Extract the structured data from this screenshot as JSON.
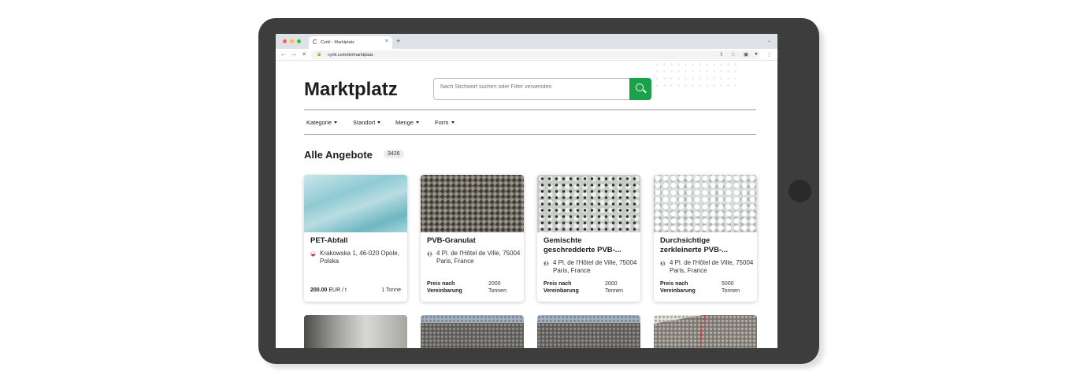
{
  "browser": {
    "tab_title": "Cyrkl - Marktplatz",
    "tab_close": "×",
    "new_tab": "+",
    "tab_menu": "⌄",
    "url": "cyrkl.com/de/marktplatz",
    "nav": {
      "back": "←",
      "forward": "→",
      "stop": "✕"
    },
    "toolbar_icons": {
      "share": "⇧",
      "bookmark": "☆",
      "sidepanel": "▣",
      "profile": "●",
      "menu": "⋮"
    },
    "window_controls": {
      "close": "#ff5f57",
      "minimize": "#febc2e",
      "maximize": "#28c840"
    }
  },
  "header": {
    "title": "Marktplatz",
    "search_placeholder": "Nach Stichwort suchen oder Filter verwenden",
    "search_button_color": "#1aa14a"
  },
  "filters": [
    {
      "label": "Kategorie"
    },
    {
      "label": "Standort"
    },
    {
      "label": "Menge"
    },
    {
      "label": "Form"
    }
  ],
  "listing": {
    "heading": "Alle Angebote",
    "count": "3426"
  },
  "cards": [
    {
      "title": "PET-Abfall",
      "country": "pl",
      "address": "Krakowska 1, 46-020 Opole, Polska",
      "price_value": "200.00",
      "price_unit": "EUR / t",
      "quantity": "1 Tonne",
      "image": "transparent plastic sheets"
    },
    {
      "title": "PVB-Granulat",
      "country": "fr",
      "address": "4 Pl. de l'Hôtel de Ville, 75004 Paris, France",
      "price_label": "Preis nach Vereinbarung",
      "quantity": "2000 Tonnen",
      "image": "dark grey granules"
    },
    {
      "title": "Gemischte geschredderte PVB-...",
      "country": "fr",
      "address": "4 Pl. de l'Hôtel de Ville, 75004 Paris, France",
      "price_label": "Preis nach Vereinbarung",
      "quantity": "2000 Tonnen",
      "image": "mixed shredded flakes"
    },
    {
      "title": "Durchsichtige zerkleinerte PVB-...",
      "country": "fr",
      "address": "4 Pl. de l'Hôtel de Ville, 75004 Paris, France",
      "price_label": "Preis nach Vereinbarung",
      "quantity": "5000 Tonnen",
      "image": "white clear flakes"
    }
  ]
}
